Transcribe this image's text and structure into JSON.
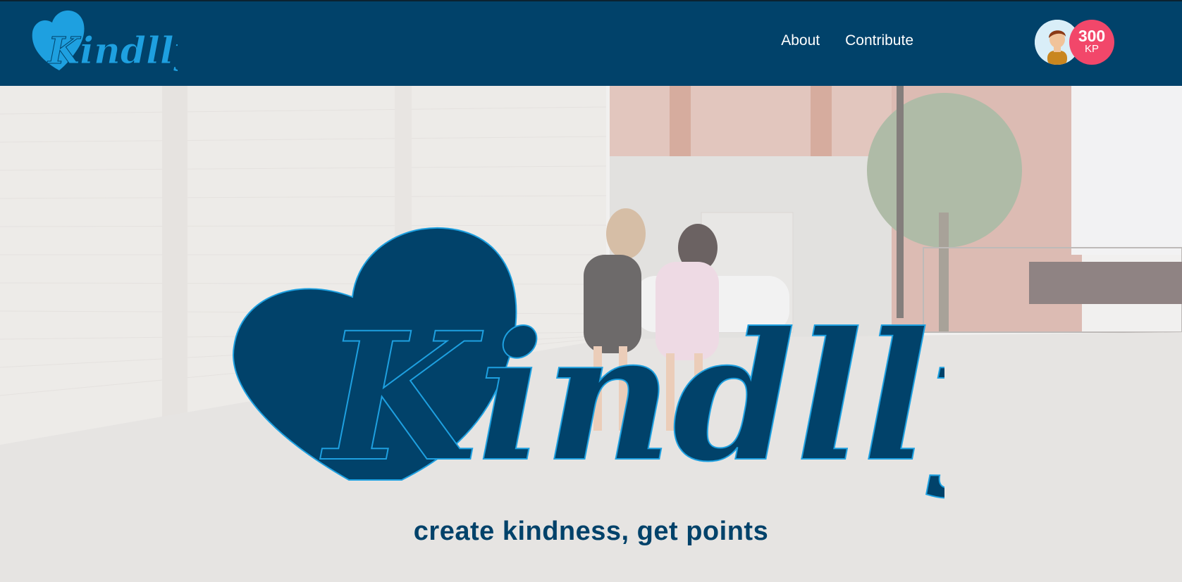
{
  "brand": {
    "name": "Kindlly",
    "color": "#01426a",
    "accent": "#1ea0e0"
  },
  "nav": {
    "links": [
      {
        "label": "About"
      },
      {
        "label": "Contribute"
      }
    ]
  },
  "user": {
    "avatar_icon": "user-avatar-icon",
    "points_value": "300",
    "points_unit": "KP",
    "badge_color": "#f2476a"
  },
  "hero": {
    "logo_text": "Kindlly",
    "tagline": "create kindness, get points"
  }
}
